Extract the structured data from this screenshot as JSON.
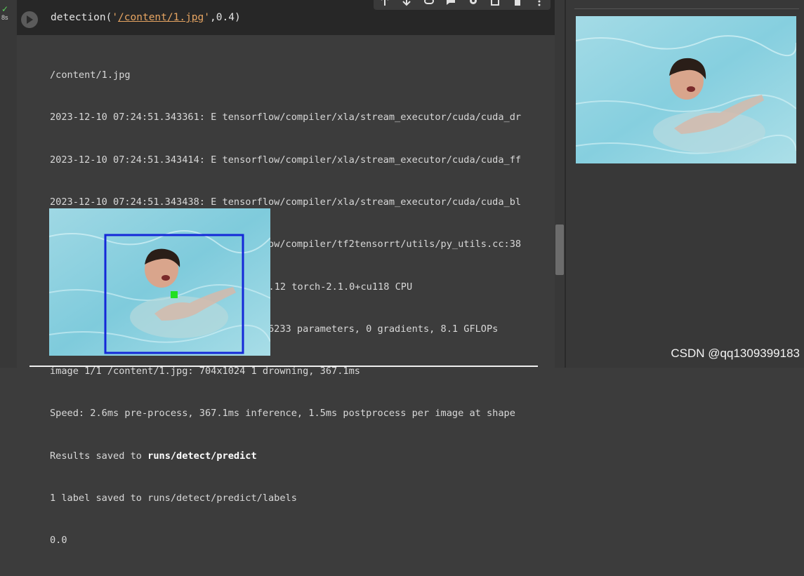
{
  "cell": {
    "status_icon": "check-icon",
    "exec_time": "8s",
    "code": {
      "func": "detection(",
      "quote_open": "'",
      "path": "/content/1.jpg",
      "quote_close": "'",
      "sep": ",",
      "arg": "0.4",
      "close": ")"
    },
    "toolbar_icons": [
      "arrow-up-icon",
      "arrow-down-icon",
      "link-icon",
      "comment-icon",
      "gear-icon",
      "mirror-cell-icon",
      "delete-icon",
      "more-icon"
    ]
  },
  "output": {
    "lines": [
      "/content/1.jpg",
      "2023-12-10 07:24:51.343361: E tensorflow/compiler/xla/stream_executor/cuda/cuda_dr",
      "2023-12-10 07:24:51.343414: E tensorflow/compiler/xla/stream_executor/cuda/cuda_ff",
      "2023-12-10 07:24:51.343438: E tensorflow/compiler/xla/stream_executor/cuda/cuda_bl",
      "2023-12-10 07:24:52.397146: W tensorflow/compiler/tf2tensorrt/utils/py_utils.cc:38",
      "Ultralytics YOLOv8.0.20 🚀 Python-3.10.12 torch-2.1.0+cu118 CPU",
      "Model summary (fused): 168 layers, 3006233 parameters, 0 gradients, 8.1 GFLOPs",
      "image 1/1 /content/1.jpg: 704x1024 1 drowning, 367.1ms",
      "Speed: 2.6ms pre-process, 367.1ms inference, 1.5ms postprocess per image at shape"
    ],
    "results_prefix": "Results saved to ",
    "results_path": "runs/detect/predict",
    "labels_line": "1 label saved to runs/detect/predict/labels",
    "value_line": "0.0",
    "box_color": "#1428d8",
    "center_point_color": "#22e022"
  },
  "side_panel": {
    "image": "pool-photo"
  },
  "watermark": "CSDN @qq1309399183",
  "colors": {
    "background": "#3c3c3c",
    "code_bg": "#272727",
    "string": "#e7a562",
    "text": "#d8d8d8"
  }
}
